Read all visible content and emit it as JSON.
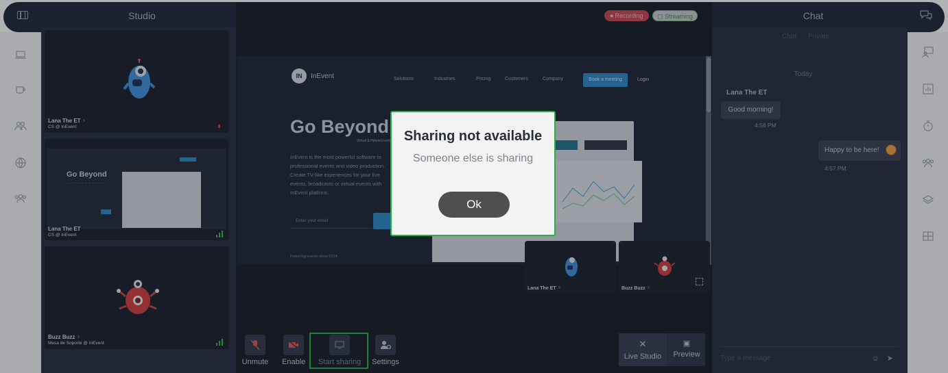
{
  "header": {
    "studio_title": "Studio",
    "chat_title": "Chat"
  },
  "status": {
    "recording": "Recording",
    "streaming": "Streaming"
  },
  "participants": [
    {
      "name": "Lana The ET",
      "role": "CS @ InEvent"
    },
    {
      "name": "Lana The ET",
      "role": "CS @ InEvent"
    },
    {
      "name": "Buzz Buzz",
      "role": "Mesa de Soporte @ InEvent"
    }
  ],
  "shared_site": {
    "brand": "InEvent",
    "nav": [
      "Solutions",
      "Industries",
      "Pricing",
      "Customers",
      "Company"
    ],
    "book_button": "Book a meeting",
    "login": "Login",
    "headline": "Go Beyond",
    "subheadline": "Virtual & Hybrid Events",
    "paragraph": "InEvent is the most powerful software to professional events and video production. Create TV-like experiences for your live events, broadcasts or virtual events with InEvent platform.",
    "email_placeholder": "Enter your email",
    "powering": "Powering events since 2014"
  },
  "thumbnail": {
    "headline": "Go Beyond"
  },
  "stage_cams": [
    {
      "name": "Lana The ET"
    },
    {
      "name": "Buzz Buzz"
    }
  ],
  "controls": {
    "unmute": "Unmute",
    "enable": "Enable",
    "start_sharing": "Start sharing",
    "settings": "Settings",
    "live_studio": "Live Studio",
    "preview": "Preview"
  },
  "chat": {
    "tabs": [
      "Chat",
      "Private"
    ],
    "day": "Today",
    "messages": [
      {
        "sender": "Lana The ET",
        "text": "Good morning!",
        "time": "4:56 PM"
      },
      {
        "text": "Happy to be here!",
        "time": "4:57 PM"
      }
    ],
    "input_placeholder": "Type a message"
  },
  "modal": {
    "title": "Sharing not available",
    "message": "Someone else is sharing",
    "ok": "Ok"
  },
  "colors": {
    "accent_green": "#20b23c",
    "recording_red": "#c8434f",
    "panel": "#222838"
  }
}
